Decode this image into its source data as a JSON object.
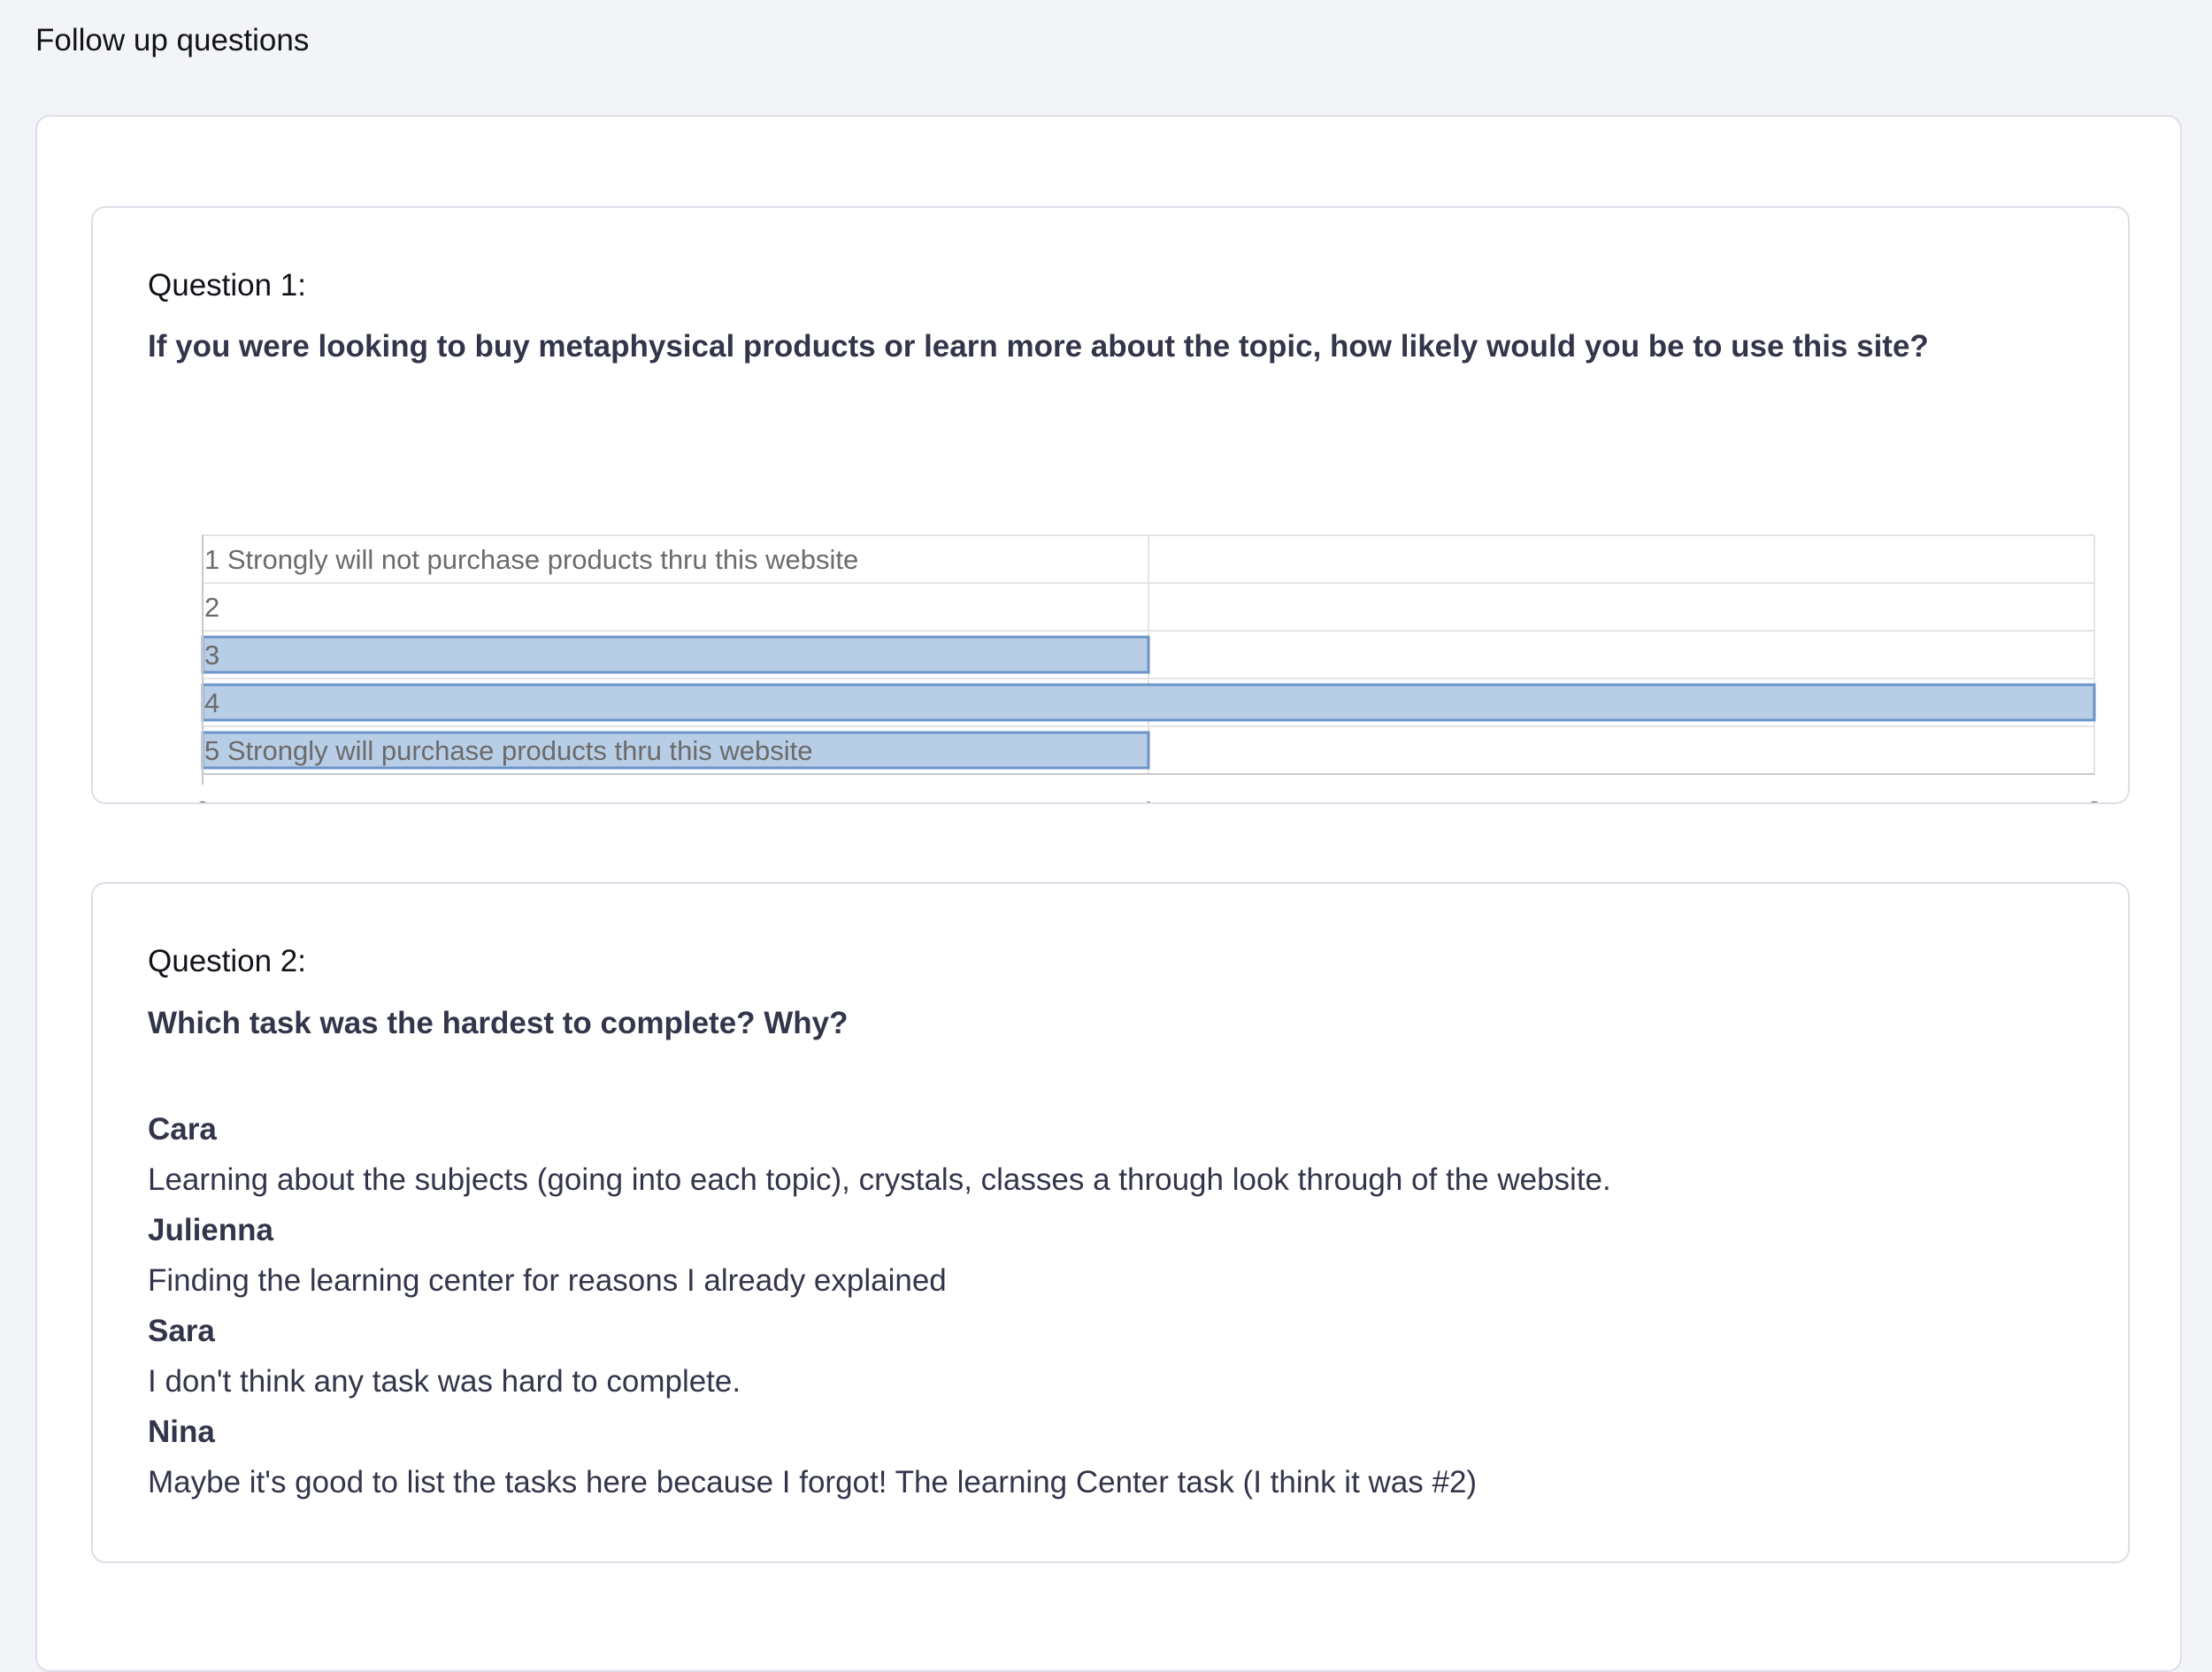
{
  "page": {
    "title": "Follow up questions"
  },
  "question1": {
    "label": "Question 1:",
    "text": "If you were looking to buy metaphysical products or learn more about the topic, how likely would you be to use this site?",
    "chart_data": {
      "type": "bar",
      "orientation": "horizontal",
      "categories": [
        "1 Strongly will not purchase products thru this website",
        "2",
        "3",
        "4",
        "5 Strongly will purchase products thru this website"
      ],
      "values": [
        0,
        0,
        1,
        2,
        1
      ],
      "xlim": [
        0,
        2
      ],
      "xticks": [
        "0",
        "1",
        "2"
      ],
      "grid": true,
      "colors": {
        "bar_fill": "#b8cde6",
        "bar_stroke": "#6d93c8",
        "grid": "#e4e4e4",
        "axis": "#c9c9c9",
        "label": "#6b6b6b"
      }
    }
  },
  "question2": {
    "label": "Question 2:",
    "text": "Which task was the hardest to complete? Why?",
    "responses": [
      {
        "name": "Cara",
        "answer": "Learning about the subjects (going into each topic), crystals, classes a through look through of the website."
      },
      {
        "name": "Julienna",
        "answer": "Finding the learning center for reasons I already explained"
      },
      {
        "name": "Sara",
        "answer": "I don't think any task was hard to complete."
      },
      {
        "name": "Nina",
        "answer": "Maybe it's good to list the tasks here because I forgot! The learning Center task (I think it was #2)"
      }
    ]
  }
}
